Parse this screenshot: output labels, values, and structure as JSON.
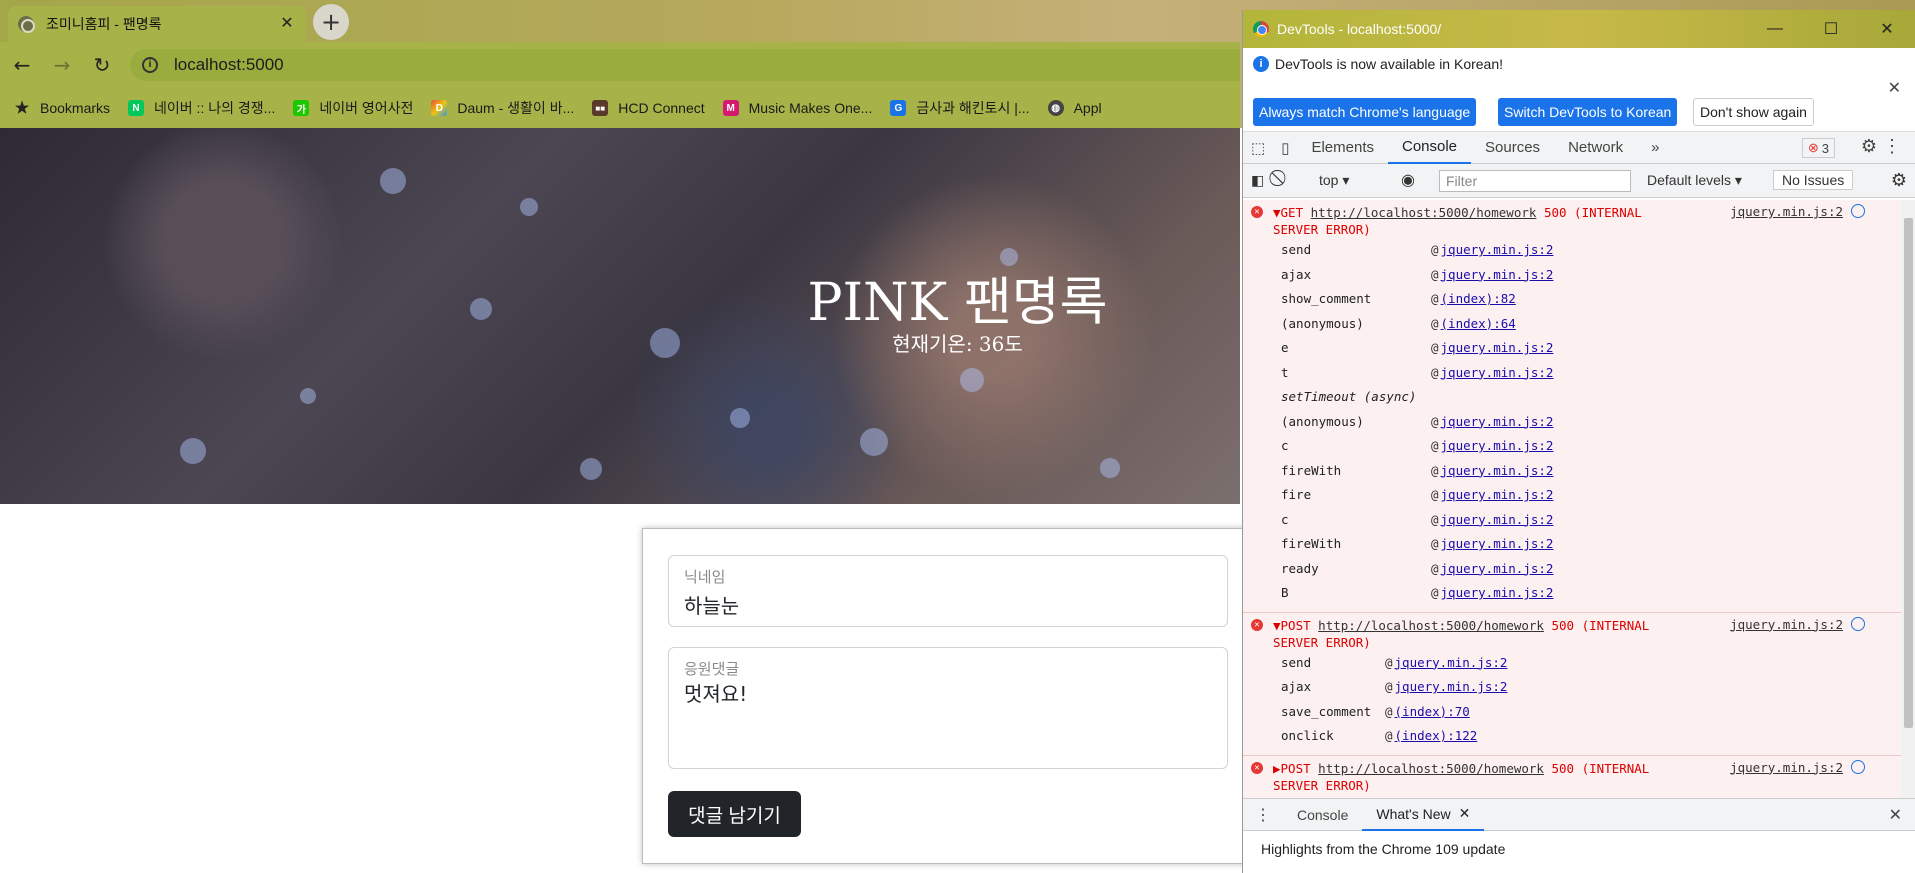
{
  "browser": {
    "tab_title": "조미니홈피 - 팬명록",
    "url": "localhost:5000",
    "bookmarks": [
      {
        "label": "Bookmarks",
        "icon": "star-icon"
      },
      {
        "label": "네이버 :: 나의 경쟁...",
        "icon": "naver-icon"
      },
      {
        "label": "네이버 영어사전",
        "icon": "naver-dict-icon"
      },
      {
        "label": "Daum - 생활이 바...",
        "icon": "daum-icon"
      },
      {
        "label": "HCD Connect",
        "icon": "hcd-icon"
      },
      {
        "label": "Music Makes One...",
        "icon": "music-icon"
      },
      {
        "label": "금사과 해킨토시 |...",
        "icon": "apple-gold-icon"
      },
      {
        "label": "Appl",
        "icon": "globe-icon"
      }
    ]
  },
  "page": {
    "title": "PINK 팬명록",
    "temperature": "현재기온: 36도",
    "form": {
      "nickname_label": "닉네임",
      "nickname_value": "하늘눈",
      "comment_label": "응원댓글",
      "comment_value": "멋져요!",
      "submit_label": "댓글 남기기"
    }
  },
  "devtools": {
    "window_title": "DevTools - localhost:5000/",
    "notice": "DevTools is now available in Korean!",
    "btn_match": "Always match Chrome's language",
    "btn_switch": "Switch DevTools to Korean",
    "btn_dont": "Don't show again",
    "tabs": [
      "Elements",
      "Console",
      "Sources",
      "Network"
    ],
    "error_count": "3",
    "context": "top",
    "filter_placeholder": "Filter",
    "levels": "Default levels",
    "issues": "No Issues",
    "errors": [
      {
        "method": "GET",
        "url": "http://localhost:5000/homework",
        "status": "500 (INTERNAL",
        "status2": "SERVER ERROR)",
        "source": "jquery.min.js:2",
        "frames": [
          {
            "fn": "send",
            "link": "jquery.min.js:2"
          },
          {
            "fn": "ajax",
            "link": "jquery.min.js:2"
          },
          {
            "fn": "show_comment",
            "link": "(index):82"
          },
          {
            "fn": "(anonymous)",
            "link": "(index):64"
          },
          {
            "fn": "e",
            "link": "jquery.min.js:2"
          },
          {
            "fn": "t",
            "link": "jquery.min.js:2"
          },
          {
            "fn": "setTimeout (async)",
            "link": ""
          },
          {
            "fn": "(anonymous)",
            "link": "jquery.min.js:2"
          },
          {
            "fn": "c",
            "link": "jquery.min.js:2"
          },
          {
            "fn": "fireWith",
            "link": "jquery.min.js:2"
          },
          {
            "fn": "fire",
            "link": "jquery.min.js:2"
          },
          {
            "fn": "c",
            "link": "jquery.min.js:2"
          },
          {
            "fn": "fireWith",
            "link": "jquery.min.js:2"
          },
          {
            "fn": "ready",
            "link": "jquery.min.js:2"
          },
          {
            "fn": "B",
            "link": "jquery.min.js:2"
          }
        ]
      },
      {
        "method": "POST",
        "url": "http://localhost:5000/homework",
        "status": "500 (INTERNAL",
        "status2": "SERVER ERROR)",
        "source": "jquery.min.js:2",
        "frames": [
          {
            "fn": "send",
            "link": "jquery.min.js:2"
          },
          {
            "fn": "ajax",
            "link": "jquery.min.js:2"
          },
          {
            "fn": "save_comment",
            "link": "(index):70"
          },
          {
            "fn": "onclick",
            "link": "(index):122"
          }
        ]
      },
      {
        "method": "POST",
        "url": "http://localhost:5000/homework",
        "status": "500 (INTERNAL",
        "status2": "SERVER ERROR)",
        "source": "jquery.min.js:2",
        "frames": []
      }
    ],
    "drawer_tabs": [
      "Console",
      "What's New"
    ],
    "drawer_text": "Highlights from the Chrome 109 update"
  }
}
